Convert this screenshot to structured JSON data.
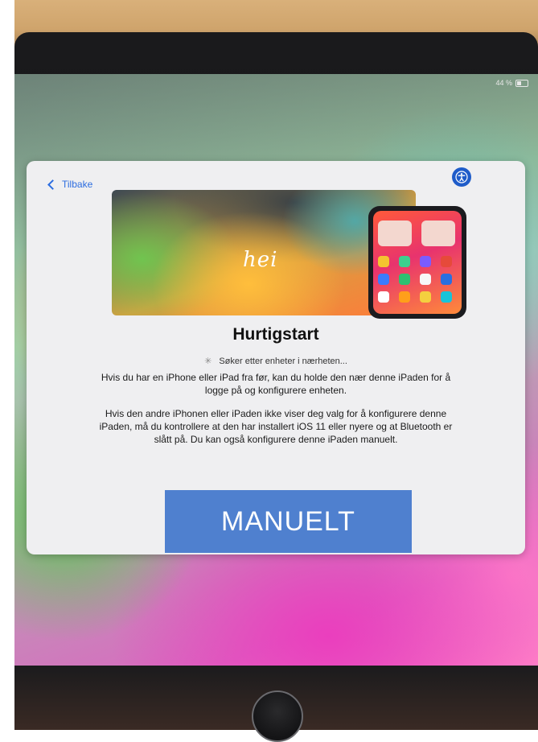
{
  "status_bar": {
    "battery_text": "44 %",
    "battery_icon": "battery-icon"
  },
  "nav": {
    "back_label": "Tilbake",
    "back_icon": "chevron-left-icon",
    "accessibility_icon": "accessibility-icon"
  },
  "hero": {
    "greeting": "hei"
  },
  "content": {
    "title": "Hurtigstart",
    "status": "Søker etter enheter i nærheten...",
    "paragraph_1": "Hvis du har en iPhone eller iPad fra før, kan du holde den nær denne iPaden for å logge på og konfigurere enheten.",
    "paragraph_2": "Hvis den andre iPhonen eller iPaden ikke viser deg valg for å konfigurere denne iPaden, må du kontrollere at den har installert iOS 11 eller nyere og at Bluetooth er slått på. Du kan også konfigurere denne iPaden manuelt."
  },
  "actions": {
    "manual_label": "MANUELT"
  },
  "colors": {
    "accent": "#2c6de0",
    "manual_button": "#4f80cf",
    "card": "#efeff1"
  }
}
